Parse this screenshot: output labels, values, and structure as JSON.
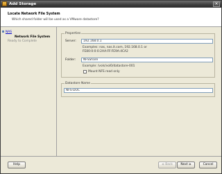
{
  "window": {
    "title": "Add Storage",
    "close_glyph": "×"
  },
  "header": {
    "title": "Locate Network File System",
    "subtitle": "Which shared folder will be used as a VMware datastore?"
  },
  "steps": [
    {
      "label": "NAS"
    },
    {
      "label": "Network File System"
    },
    {
      "label": "Ready to Complete"
    }
  ],
  "properties": {
    "legend": "Properties",
    "server_label": "Server:",
    "server_value": "192.168.0.1",
    "server_examples": [
      "Examples: nas, nas.it.com, 192.168.0.1 or",
      "FE80:0:0:0:2AA:FF:FE9A:4CA2"
    ],
    "folder_label": "Folder:",
    "folder_value": "NFSShare",
    "folder_example": "Example: /vols/vol0/datastore-001",
    "mount_label": "Mount NFS read only"
  },
  "datastore": {
    "legend": "Datastore Name",
    "value": "NFS-DOC"
  },
  "buttons": {
    "help": "Help",
    "back": "≤ Back",
    "next": "Next ≥",
    "cancel": "Cancel"
  }
}
